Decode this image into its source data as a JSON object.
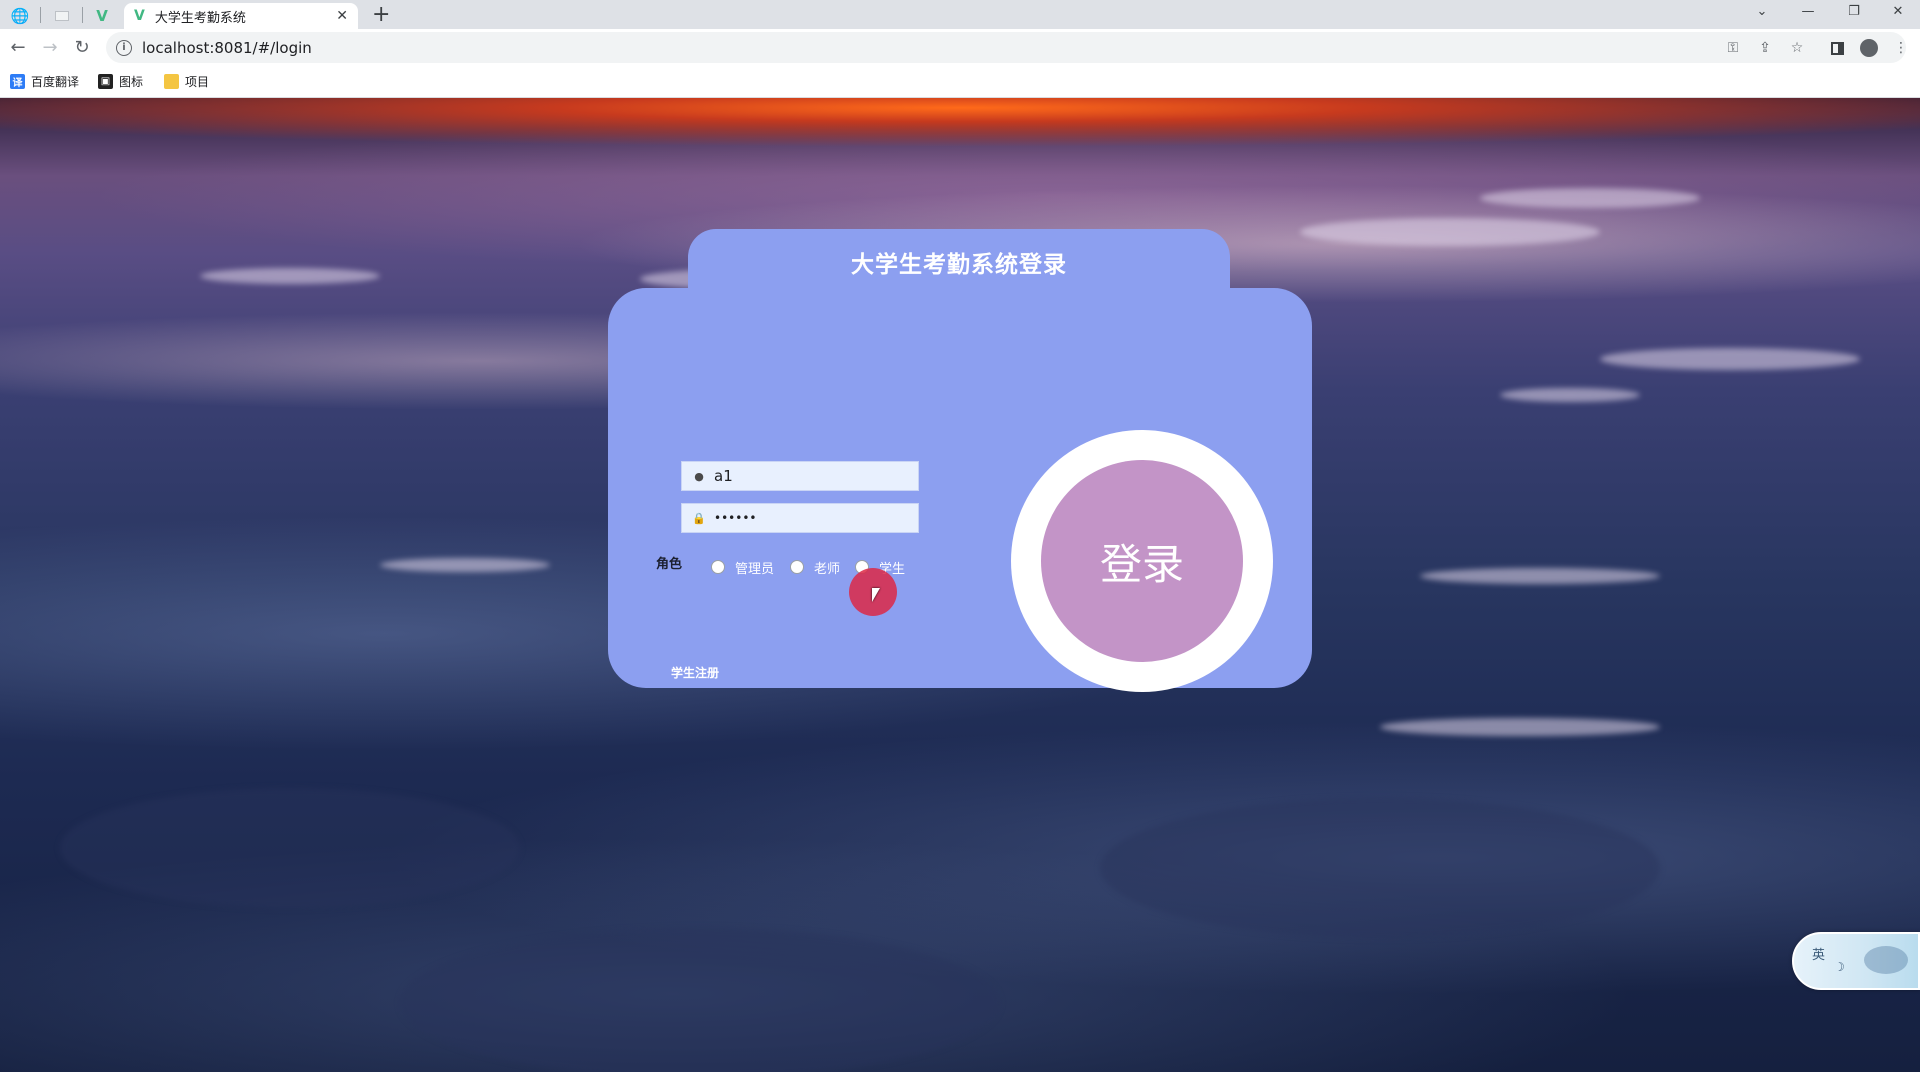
{
  "browser": {
    "tab_title": "大学生考勤系统",
    "url": "localhost:8081/#/login",
    "bookmarks": [
      {
        "label": "百度翻译",
        "icon": "translate-icon",
        "color": "#2d7cf6"
      },
      {
        "label": "图标",
        "icon": "image-icon",
        "color": "#222222"
      },
      {
        "label": "项目",
        "icon": "folder-icon",
        "color": "#f4c542"
      }
    ]
  },
  "login": {
    "title": "大学生考勤系统登录",
    "username_value": "a1",
    "password_value": "••••••",
    "role_label": "角色",
    "roles": [
      "管理员",
      "老师",
      "学生"
    ],
    "register_label": "学生注册",
    "login_button": "登录"
  },
  "ime": {
    "label": "英"
  },
  "colors": {
    "card": "#8c9ff0",
    "login_button": "#c394c7",
    "input_bg": "#e8f0fe"
  }
}
